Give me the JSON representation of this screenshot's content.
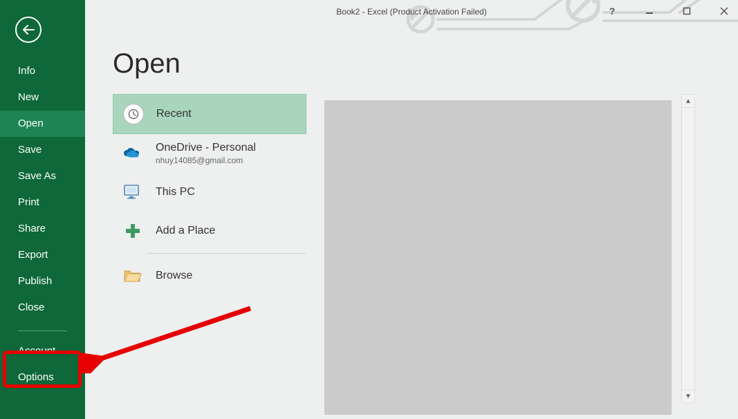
{
  "window": {
    "title": "Book2 - Excel (Product Activation Failed)"
  },
  "sidebar": {
    "items": {
      "info": "Info",
      "new": "New",
      "open": "Open",
      "save": "Save",
      "saveas": "Save As",
      "print": "Print",
      "share": "Share",
      "export": "Export",
      "publish": "Publish",
      "close": "Close",
      "account": "Account",
      "options": "Options"
    }
  },
  "page": {
    "title": "Open"
  },
  "sources": {
    "recent": {
      "label": "Recent"
    },
    "onedrive": {
      "label": "OneDrive - Personal",
      "sub": "nhuy14085@gmail.com"
    },
    "thispc": {
      "label": "This PC"
    },
    "addplace": {
      "label": "Add a Place"
    },
    "browse": {
      "label": "Browse"
    }
  }
}
